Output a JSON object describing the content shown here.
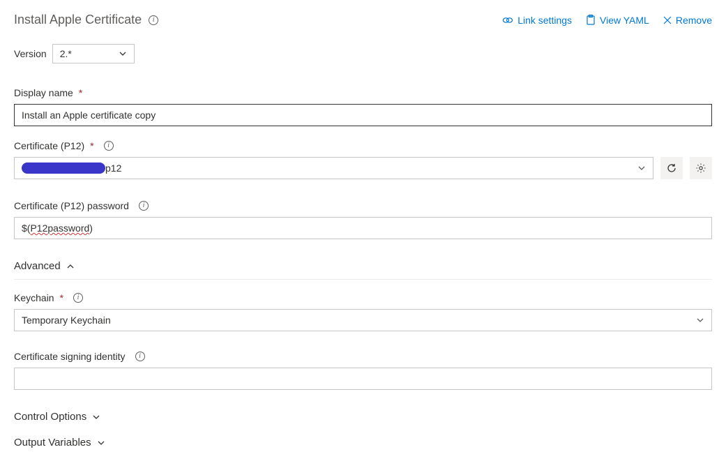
{
  "header": {
    "title": "Install Apple Certificate",
    "links": {
      "link_settings": "Link settings",
      "view_yaml": "View YAML",
      "remove": "Remove"
    }
  },
  "version": {
    "label": "Version",
    "value": "2.*"
  },
  "fields": {
    "display_name": {
      "label": "Display name",
      "value": "Install an Apple certificate copy"
    },
    "certificate_p12": {
      "label": "Certificate (P12)",
      "value_suffix": "p12"
    },
    "p12_password": {
      "label": "Certificate (P12) password",
      "value_prefix": "$(",
      "value_mid": "P12password",
      "value_suffix": ")"
    },
    "keychain": {
      "label": "Keychain",
      "value": "Temporary Keychain"
    },
    "signing_identity": {
      "label": "Certificate signing identity",
      "value": ""
    }
  },
  "sections": {
    "advanced": "Advanced",
    "control_options": "Control Options",
    "output_variables": "Output Variables"
  }
}
